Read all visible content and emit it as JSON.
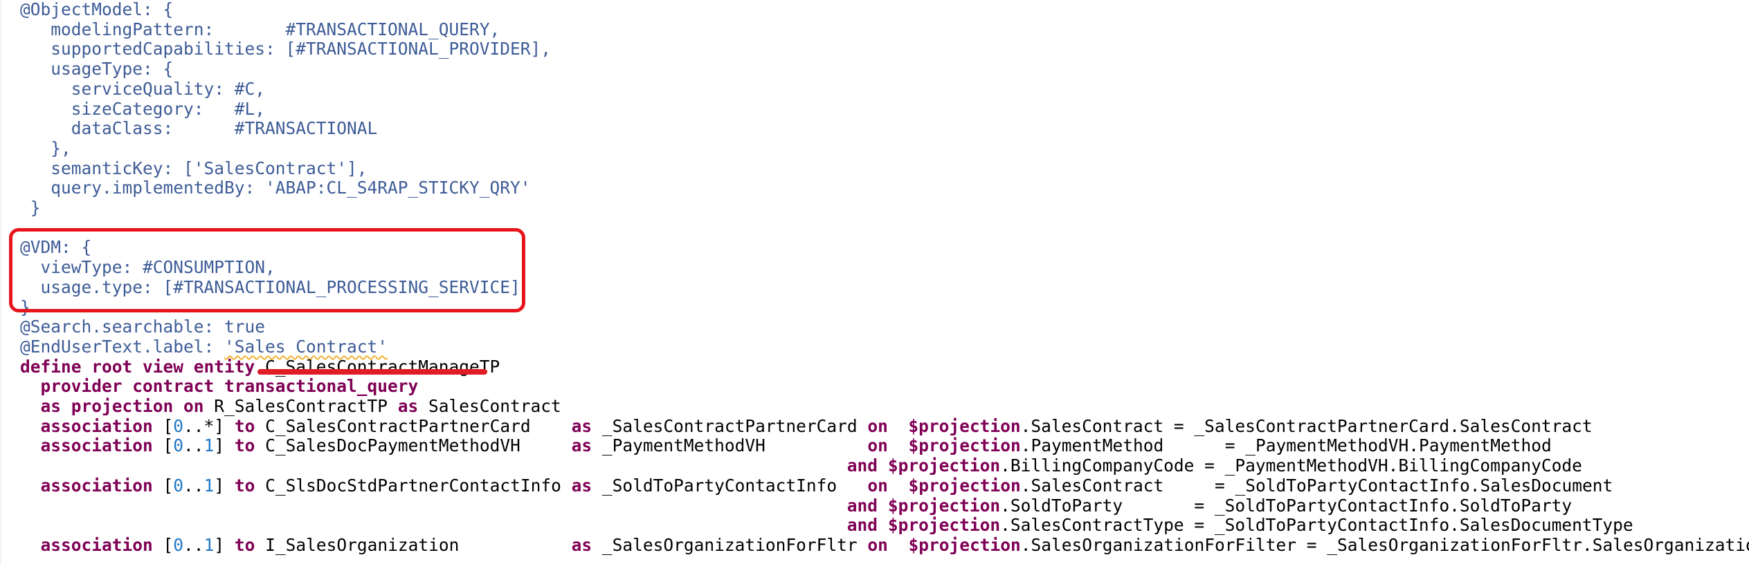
{
  "editor": {
    "lines": [
      [
        {
          "t": "@ObjectModel: {",
          "c": "ann"
        }
      ],
      [
        {
          "t": "   modelingPattern:       #TRANSACTIONAL_QUERY,",
          "c": "ann"
        }
      ],
      [
        {
          "t": "   supportedCapabilities: [#TRANSACTIONAL_PROVIDER],",
          "c": "ann"
        }
      ],
      [
        {
          "t": "   usageType: {",
          "c": "ann"
        }
      ],
      [
        {
          "t": "     serviceQuality: #C,",
          "c": "ann"
        }
      ],
      [
        {
          "t": "     sizeCategory:   #L,",
          "c": "ann"
        }
      ],
      [
        {
          "t": "     dataClass:      #TRANSACTIONAL",
          "c": "ann"
        }
      ],
      [
        {
          "t": "   },",
          "c": "ann"
        }
      ],
      [
        {
          "t": "   semanticKey: ['SalesContract'],",
          "c": "ann"
        }
      ],
      [
        {
          "t": "   query.implementedBy: 'ABAP:CL_S4RAP_STICKY_QRY'",
          "c": "ann"
        }
      ],
      [
        {
          "t": " }",
          "c": "ann"
        }
      ],
      [],
      [
        {
          "t": "@VDM: {",
          "c": "ann"
        }
      ],
      [
        {
          "t": "  viewType: #CONSUMPTION,",
          "c": "ann"
        }
      ],
      [
        {
          "t": "  usage.type: [#TRANSACTIONAL_PROCESSING_SERVICE]",
          "c": "ann"
        }
      ],
      [
        {
          "t": "}",
          "c": "ann"
        }
      ],
      [
        {
          "t": "@Search.searchable: true",
          "c": "ann"
        }
      ],
      [
        {
          "t": "@EndUserText.label: ",
          "c": "ann"
        },
        {
          "t": "'Sales Contract'",
          "c": "str squiggle"
        }
      ],
      [
        {
          "t": "define root view entity ",
          "c": "kw"
        },
        {
          "t": "C_SalesContractManageTP",
          "c": "plain"
        }
      ],
      [
        {
          "t": "  provider contract transactional_query",
          "c": "kw"
        }
      ],
      [
        {
          "t": "  as projection on ",
          "c": "kw"
        },
        {
          "t": "R_SalesContractTP ",
          "c": "plain"
        },
        {
          "t": "as",
          "c": "kw"
        },
        {
          "t": " SalesContract",
          "c": "plain"
        }
      ],
      [
        {
          "t": "  association ",
          "c": "kw"
        },
        {
          "t": "[",
          "c": "plain"
        },
        {
          "t": "0",
          "c": "num"
        },
        {
          "t": "..*] ",
          "c": "plain"
        },
        {
          "t": "to",
          "c": "kw"
        },
        {
          "t": " C_SalesContractPartnerCard    ",
          "c": "plain"
        },
        {
          "t": "as",
          "c": "kw"
        },
        {
          "t": " _SalesContractPartnerCard ",
          "c": "plain"
        },
        {
          "t": "on",
          "c": "kw"
        },
        {
          "t": "  ",
          "c": "plain"
        },
        {
          "t": "$projection",
          "c": "kw"
        },
        {
          "t": ".SalesContract = _SalesContractPartnerCard.SalesContract",
          "c": "plain"
        }
      ],
      [
        {
          "t": "  association ",
          "c": "kw"
        },
        {
          "t": "[",
          "c": "plain"
        },
        {
          "t": "0",
          "c": "num"
        },
        {
          "t": "..",
          "c": "plain"
        },
        {
          "t": "1",
          "c": "num"
        },
        {
          "t": "] ",
          "c": "plain"
        },
        {
          "t": "to",
          "c": "kw"
        },
        {
          "t": " C_SalesDocPaymentMethodVH     ",
          "c": "plain"
        },
        {
          "t": "as",
          "c": "kw"
        },
        {
          "t": " _PaymentMethodVH          ",
          "c": "plain"
        },
        {
          "t": "on",
          "c": "kw"
        },
        {
          "t": "  ",
          "c": "plain"
        },
        {
          "t": "$projection",
          "c": "kw"
        },
        {
          "t": ".PaymentMethod      = _PaymentMethodVH.PaymentMethod",
          "c": "plain"
        }
      ],
      [
        {
          "t": "                                                                                 ",
          "c": "plain"
        },
        {
          "t": "and",
          "c": "kw"
        },
        {
          "t": " ",
          "c": "plain"
        },
        {
          "t": "$projection",
          "c": "kw"
        },
        {
          "t": ".BillingCompanyCode = _PaymentMethodVH.BillingCompanyCode",
          "c": "plain"
        }
      ],
      [
        {
          "t": "  association ",
          "c": "kw"
        },
        {
          "t": "[",
          "c": "plain"
        },
        {
          "t": "0",
          "c": "num"
        },
        {
          "t": "..",
          "c": "plain"
        },
        {
          "t": "1",
          "c": "num"
        },
        {
          "t": "] ",
          "c": "plain"
        },
        {
          "t": "to",
          "c": "kw"
        },
        {
          "t": " C_SlsDocStdPartnerContactInfo ",
          "c": "plain"
        },
        {
          "t": "as",
          "c": "kw"
        },
        {
          "t": " _SoldToPartyContactInfo   ",
          "c": "plain"
        },
        {
          "t": "on",
          "c": "kw"
        },
        {
          "t": "  ",
          "c": "plain"
        },
        {
          "t": "$projection",
          "c": "kw"
        },
        {
          "t": ".SalesContract     = _SoldToPartyContactInfo.SalesDocument",
          "c": "plain"
        }
      ],
      [
        {
          "t": "                                                                                 ",
          "c": "plain"
        },
        {
          "t": "and",
          "c": "kw"
        },
        {
          "t": " ",
          "c": "plain"
        },
        {
          "t": "$projection",
          "c": "kw"
        },
        {
          "t": ".SoldToParty       = _SoldToPartyContactInfo.SoldToParty",
          "c": "plain"
        }
      ],
      [
        {
          "t": "                                                                                 ",
          "c": "plain"
        },
        {
          "t": "and",
          "c": "kw"
        },
        {
          "t": " ",
          "c": "plain"
        },
        {
          "t": "$projection",
          "c": "kw"
        },
        {
          "t": ".SalesContractType = _SoldToPartyContactInfo.SalesDocumentType",
          "c": "plain"
        }
      ],
      [
        {
          "t": "  association ",
          "c": "kw"
        },
        {
          "t": "[",
          "c": "plain"
        },
        {
          "t": "0",
          "c": "num"
        },
        {
          "t": "..",
          "c": "plain"
        },
        {
          "t": "1",
          "c": "num"
        },
        {
          "t": "] ",
          "c": "plain"
        },
        {
          "t": "to",
          "c": "kw"
        },
        {
          "t": " I_SalesOrganization           ",
          "c": "plain"
        },
        {
          "t": "as",
          "c": "kw"
        },
        {
          "t": " _SalesOrganizationForFltr ",
          "c": "plain"
        },
        {
          "t": "on",
          "c": "kw"
        },
        {
          "t": "  ",
          "c": "plain"
        },
        {
          "t": "$projection",
          "c": "kw"
        },
        {
          "t": ".SalesOrganizationForFilter = _SalesOrganizationForFltr.SalesOrganization",
          "c": "plain"
        }
      ]
    ]
  },
  "colors": {
    "annotation": "#3e5c97",
    "keyword": "#7f0055",
    "number": "#1f77c6",
    "plain": "#000000",
    "highlight_box": "#e8141c",
    "underline_mark": "#e01c24",
    "squiggle": "#f2b233"
  }
}
